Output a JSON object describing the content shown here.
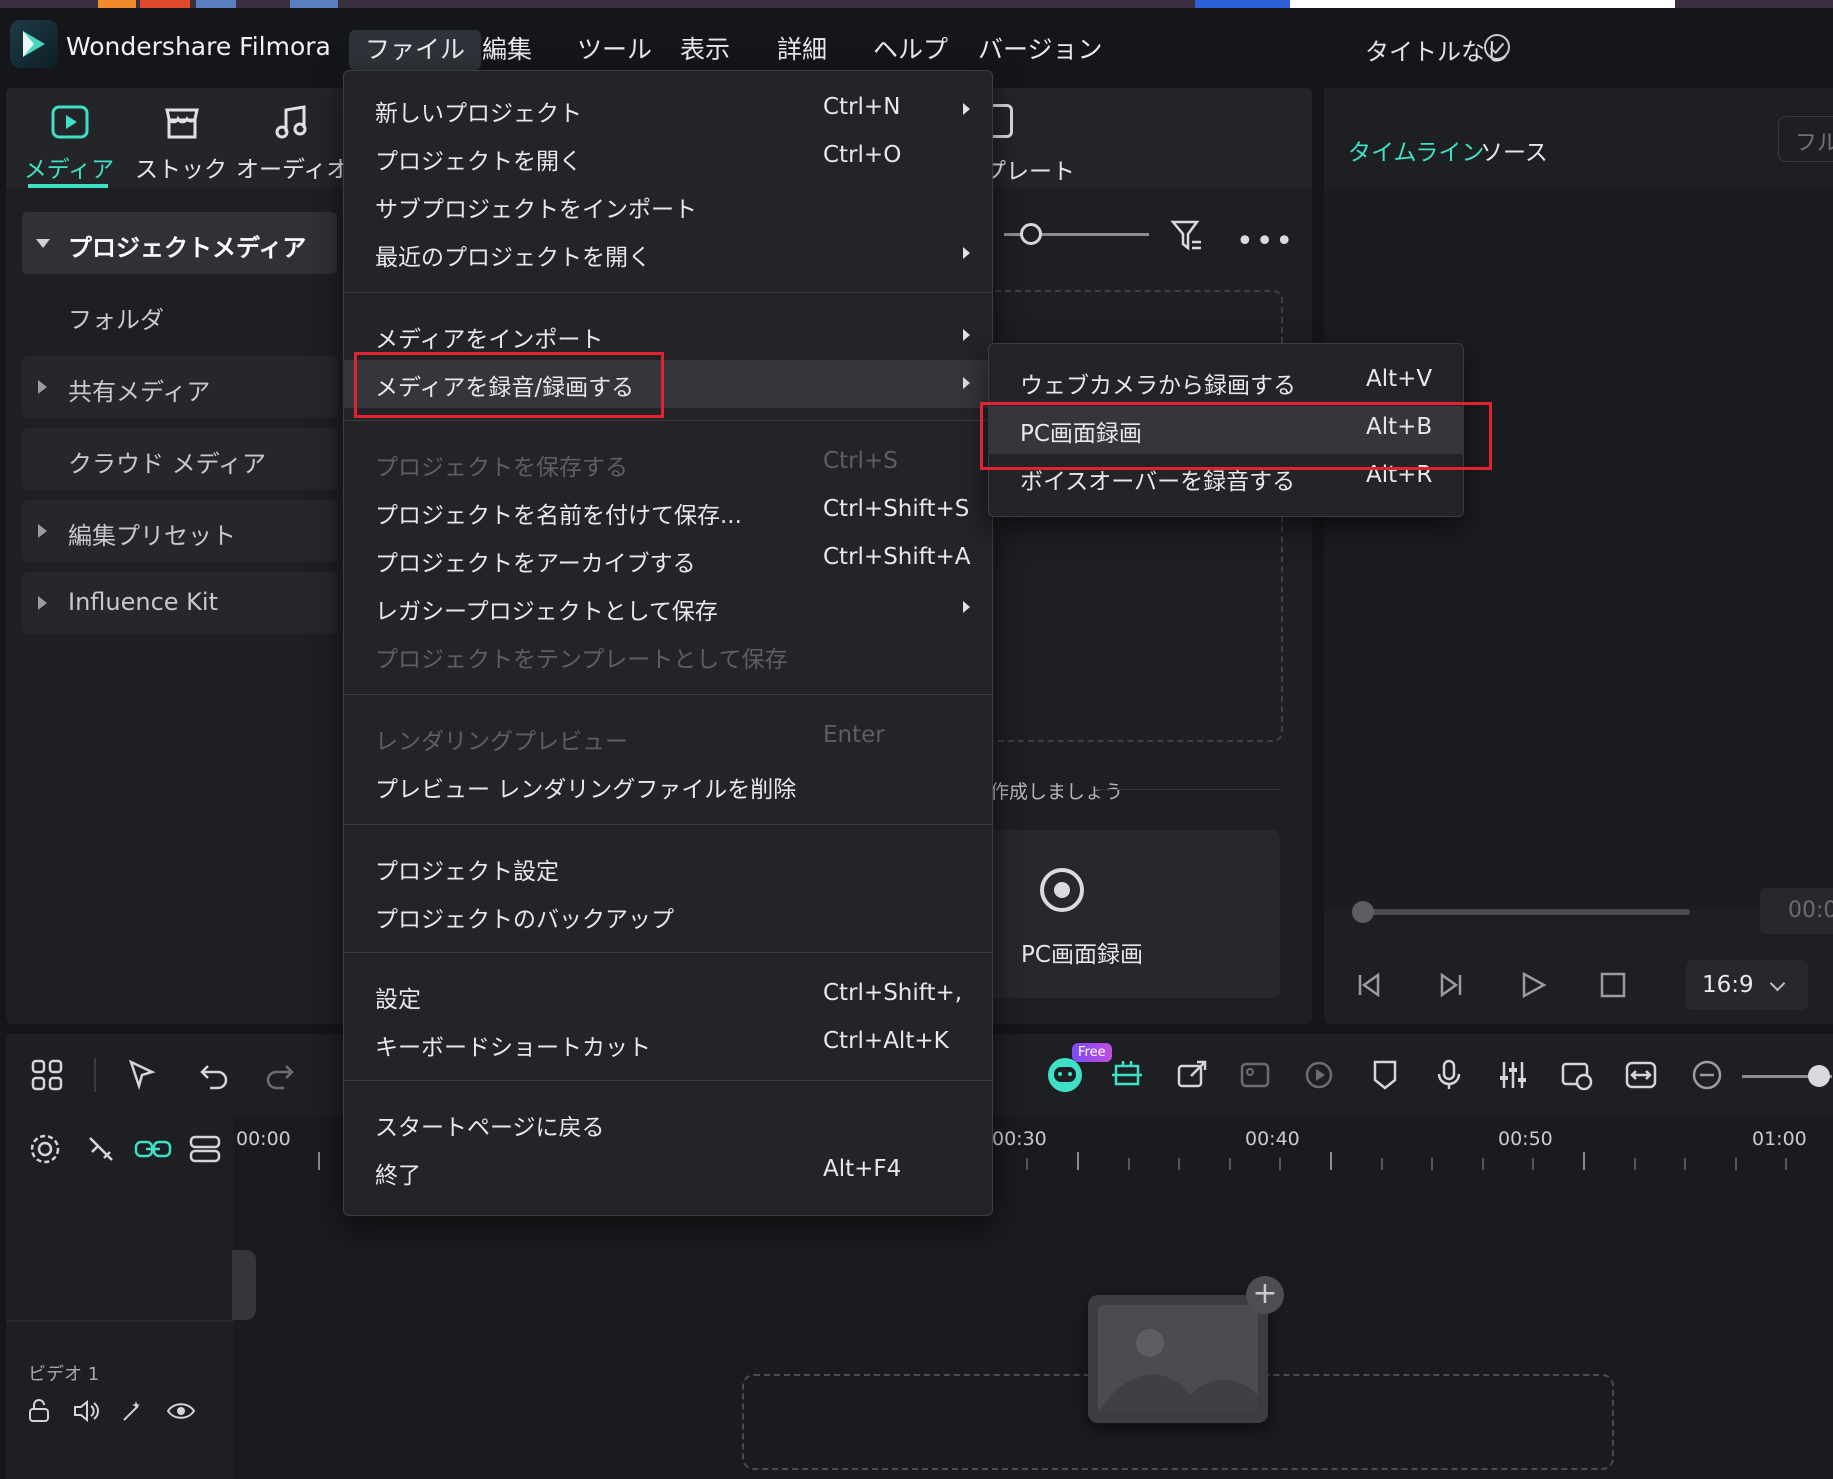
{
  "app": {
    "name": "Wondershare Filmora",
    "project_title": "タイトルなし"
  },
  "menubar": [
    "ファイル",
    "編集",
    "ツール",
    "表示",
    "詳細",
    "ヘルプ",
    "バージョン"
  ],
  "media_tabs": {
    "media": "メディア",
    "stock": "ストック",
    "audio": "オーディオ",
    "template_partial": "プレート"
  },
  "sidebar": {
    "project_media": "プロジェクトメディア",
    "folder": "フォルダ",
    "shared_media": "共有メディア",
    "cloud_media": "クラウド メディア",
    "edit_presets": "編集プリセット",
    "influence_kit": "Influence Kit"
  },
  "media_area": {
    "create_hint_partial": "作成しましょう",
    "pc_record_label": "PC画面録画",
    "more": "•••"
  },
  "preview": {
    "tab_timeline": "タイムライン",
    "tab_source": "ソース",
    "full_button_partial": "フル",
    "time_partial": "00:0",
    "aspect": "16:9"
  },
  "timeline": {
    "free_badge": "Free",
    "ruler": [
      "00:00",
      "00:30",
      "00:40",
      "00:50",
      "01:00"
    ],
    "track_label": "ビデオ 1",
    "drop_plus": "+"
  },
  "file_menu": [
    {
      "label": "新しいプロジェクト",
      "shortcut": "Ctrl+N",
      "submenu": true,
      "disabled": false
    },
    {
      "label": "プロジェクトを開く",
      "shortcut": "Ctrl+O",
      "submenu": false,
      "disabled": false
    },
    {
      "label": "サブプロジェクトをインポート",
      "shortcut": "",
      "submenu": false,
      "disabled": false
    },
    {
      "label": "最近のプロジェクトを開く",
      "shortcut": "",
      "submenu": true,
      "disabled": false
    },
    {
      "label": "メディアをインポート",
      "shortcut": "",
      "submenu": true,
      "disabled": false
    },
    {
      "label": "メディアを録音/録画する",
      "shortcut": "",
      "submenu": true,
      "disabled": false
    },
    {
      "label": "プロジェクトを保存する",
      "shortcut": "Ctrl+S",
      "submenu": false,
      "disabled": true
    },
    {
      "label": "プロジェクトを名前を付けて保存...",
      "shortcut": "Ctrl+Shift+S",
      "submenu": false,
      "disabled": false
    },
    {
      "label": "プロジェクトをアーカイブする",
      "shortcut": "Ctrl+Shift+A",
      "submenu": false,
      "disabled": false
    },
    {
      "label": "レガシープロジェクトとして保存",
      "shortcut": "",
      "submenu": true,
      "disabled": false
    },
    {
      "label": "プロジェクトをテンプレートとして保存",
      "shortcut": "",
      "submenu": false,
      "disabled": true
    },
    {
      "label": "レンダリングプレビュー",
      "shortcut": "Enter",
      "submenu": false,
      "disabled": true
    },
    {
      "label": "プレビュー レンダリングファイルを削除",
      "shortcut": "",
      "submenu": false,
      "disabled": false
    },
    {
      "label": "プロジェクト設定",
      "shortcut": "",
      "submenu": false,
      "disabled": false
    },
    {
      "label": "プロジェクトのバックアップ",
      "shortcut": "",
      "submenu": false,
      "disabled": false
    },
    {
      "label": "設定",
      "shortcut": "Ctrl+Shift+,",
      "submenu": false,
      "disabled": false
    },
    {
      "label": "キーボードショートカット",
      "shortcut": "Ctrl+Alt+K",
      "submenu": false,
      "disabled": false
    },
    {
      "label": "スタートページに戻る",
      "shortcut": "",
      "submenu": false,
      "disabled": false
    },
    {
      "label": "終了",
      "shortcut": "Alt+F4",
      "submenu": false,
      "disabled": false
    }
  ],
  "record_submenu": [
    {
      "label": "ウェブカメラから録画する",
      "shortcut": "Alt+V"
    },
    {
      "label": "PC画面録画",
      "shortcut": "Alt+B"
    },
    {
      "label": "ボイスオーバーを録音する",
      "shortcut": "Alt+R"
    }
  ],
  "colors": {
    "accent": "#3fe0c5",
    "highlight_box": "#e0232e",
    "background": "#151619"
  }
}
